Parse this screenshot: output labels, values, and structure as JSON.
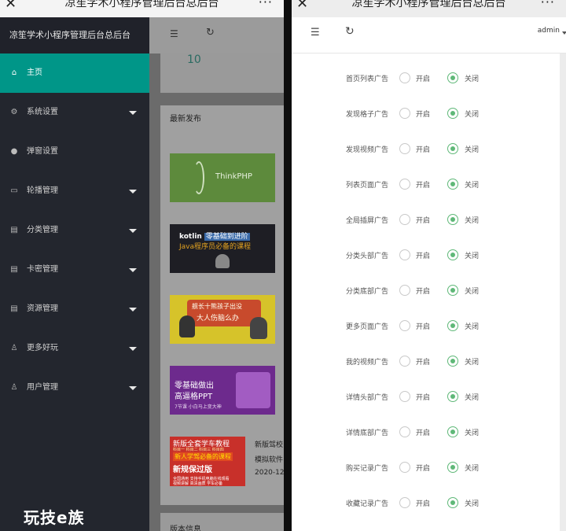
{
  "left_phone": {
    "window_title": "凉笙学术小程序管理后台总后台",
    "close_glyph": "✕",
    "more_glyph": "···",
    "brand": "凉笙学术小程序管理后台总后台",
    "nav": [
      {
        "label": "主页",
        "icon": "home-icon",
        "glyph": "⌂",
        "active": true,
        "expandable": false
      },
      {
        "label": "系统设置",
        "icon": "gear-icon",
        "glyph": "⚙",
        "active": false,
        "expandable": true
      },
      {
        "label": "弹窗设置",
        "icon": "dot-icon",
        "glyph": "●",
        "active": false,
        "expandable": false
      },
      {
        "label": "轮播管理",
        "icon": "image-icon",
        "glyph": "▭",
        "active": false,
        "expandable": true
      },
      {
        "label": "分类管理",
        "icon": "list-icon",
        "glyph": "▤",
        "active": false,
        "expandable": true
      },
      {
        "label": "卡密管理",
        "icon": "list-icon",
        "glyph": "▤",
        "active": false,
        "expandable": true
      },
      {
        "label": "资源管理",
        "icon": "list-icon",
        "glyph": "▤",
        "active": false,
        "expandable": true
      },
      {
        "label": "更多好玩",
        "icon": "user-icon",
        "glyph": "♙",
        "active": false,
        "expandable": true
      },
      {
        "label": "用户管理",
        "icon": "user-icon",
        "glyph": "♙",
        "active": false,
        "expandable": true
      }
    ],
    "watermark": "玩技e族",
    "header": {
      "menu_glyph": "☰",
      "refresh_glyph": "↻"
    },
    "stat_value": "10",
    "latest_title": "最新发布",
    "thumbs": {
      "thinkphp": "ThinkPHP",
      "kotlin_line1_a": "kotlin",
      "kotlin_line1_b": "零基础到进阶",
      "kotlin_line2": "Java程序员必备的课程",
      "th3_line1": "舰长十熊孩子出没",
      "th3_line2": "大人伤脑么办",
      "ppt_line1": "零基础做出",
      "ppt_line2": "高逼格PPT",
      "ppt_line3": "7节课 小白马上变大神",
      "t5_a": "新版全套学车教程",
      "t5_b": "科目一 科目二 科目三 科目四",
      "t5_c": "新人学驾必备的课程",
      "t5_d": "新规保过版",
      "t5_e": "全国通用 支持手机电脑在线观看",
      "t5_f": "视频讲解 高清画质 学车必备"
    },
    "item5_title_1": "新版驾校",
    "item5_title_2": "模拟软件",
    "item5_date": "2020-12",
    "version_title": "版本信息"
  },
  "right_phone": {
    "window_title": "凉笙学术小程序管理后台总后台",
    "close_glyph": "✕",
    "more_glyph": "···",
    "header": {
      "menu_glyph": "☰",
      "refresh_glyph": "↻",
      "user": "admin"
    },
    "open_label": "开启",
    "close_label": "关闭",
    "settings": [
      {
        "label": "首页列表广告",
        "value": "关闭"
      },
      {
        "label": "发现格子广告",
        "value": "关闭"
      },
      {
        "label": "发现视频广告",
        "value": "关闭"
      },
      {
        "label": "列表页面广告",
        "value": "关闭"
      },
      {
        "label": "全局插屏广告",
        "value": "关闭"
      },
      {
        "label": "分类头部广告",
        "value": "关闭"
      },
      {
        "label": "分类底部广告",
        "value": "关闭"
      },
      {
        "label": "更多页面广告",
        "value": "关闭"
      },
      {
        "label": "我的视频广告",
        "value": "关闭"
      },
      {
        "label": "详情头部广告",
        "value": "关闭"
      },
      {
        "label": "详情底部广告",
        "value": "关闭"
      },
      {
        "label": "购买记录广告",
        "value": "关闭"
      },
      {
        "label": "收藏记录广告",
        "value": "关闭"
      }
    ]
  },
  "colors": {
    "accent": "#009688",
    "radio_on": "#5fb878",
    "sidebar": "#23262e"
  }
}
